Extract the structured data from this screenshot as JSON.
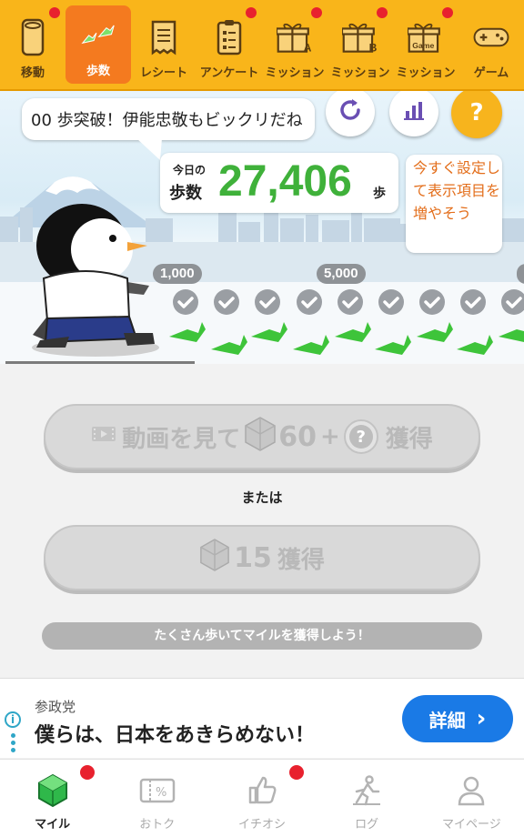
{
  "top_tabs": [
    {
      "label": "移動",
      "icon": "phone-icon",
      "dot": true,
      "active": false
    },
    {
      "label": "歩数",
      "icon": "footprints-icon",
      "dot": false,
      "active": true
    },
    {
      "label": "レシート",
      "icon": "receipt-icon",
      "dot": false,
      "active": false
    },
    {
      "label": "アンケート",
      "icon": "clipboard-icon",
      "dot": true,
      "active": false
    },
    {
      "label": "ミッション",
      "icon": "gift-a-icon",
      "dot": true,
      "active": false
    },
    {
      "label": "ミッション",
      "icon": "gift-b-icon",
      "dot": true,
      "active": false
    },
    {
      "label": "ミッション",
      "icon": "gift-game-icon",
      "dot": true,
      "active": false
    },
    {
      "label": "ゲーム",
      "icon": "gamepad-icon",
      "dot": false,
      "active": false
    }
  ],
  "gift_letters": {
    "a": "A",
    "b": "B",
    "game": "Game"
  },
  "scene": {
    "speech": "00 歩突破！伊能忠敬もビックリだね",
    "today_label_1": "今日の",
    "today_label_2": "歩数",
    "steps": "27,406",
    "steps_unit": "歩",
    "tip": "今すぐ設定して表示項目を増やそう",
    "help_symbol": "?",
    "milestones": [
      "1,000",
      "5,000"
    ]
  },
  "buttons": {
    "video_prefix": "動画を見て",
    "video_amount": "60",
    "video_plus": "+",
    "video_question": "?",
    "video_suffix": "獲得",
    "or_text": "または",
    "claim_amount": "15",
    "claim_suffix": "獲得",
    "hint": "たくさん歩いてマイルを獲得しよう！"
  },
  "ad": {
    "sponsor": "参政党",
    "headline": "僕らは、日本をあきらめない！",
    "cta": "詳細",
    "cta_arrow": "›",
    "info_symbol": "i"
  },
  "bottom_nav": [
    {
      "label": "マイル",
      "icon": "gem-icon",
      "dot": true,
      "active": true
    },
    {
      "label": "おトク",
      "icon": "coupon-icon",
      "dot": false,
      "active": false
    },
    {
      "label": "イチオシ",
      "icon": "thumbs-up-icon",
      "dot": true,
      "active": false
    },
    {
      "label": "ログ",
      "icon": "runner-icon",
      "dot": false,
      "active": false
    },
    {
      "label": "マイページ",
      "icon": "person-icon",
      "dot": false,
      "active": false
    }
  ],
  "colors": {
    "topbar": "#f9b51a",
    "active_tab": "#f47a1f",
    "steps_green": "#3fb13a",
    "tip_orange": "#e36e1b",
    "cta_blue": "#1a7ae6",
    "badge_red": "#e8212e"
  }
}
